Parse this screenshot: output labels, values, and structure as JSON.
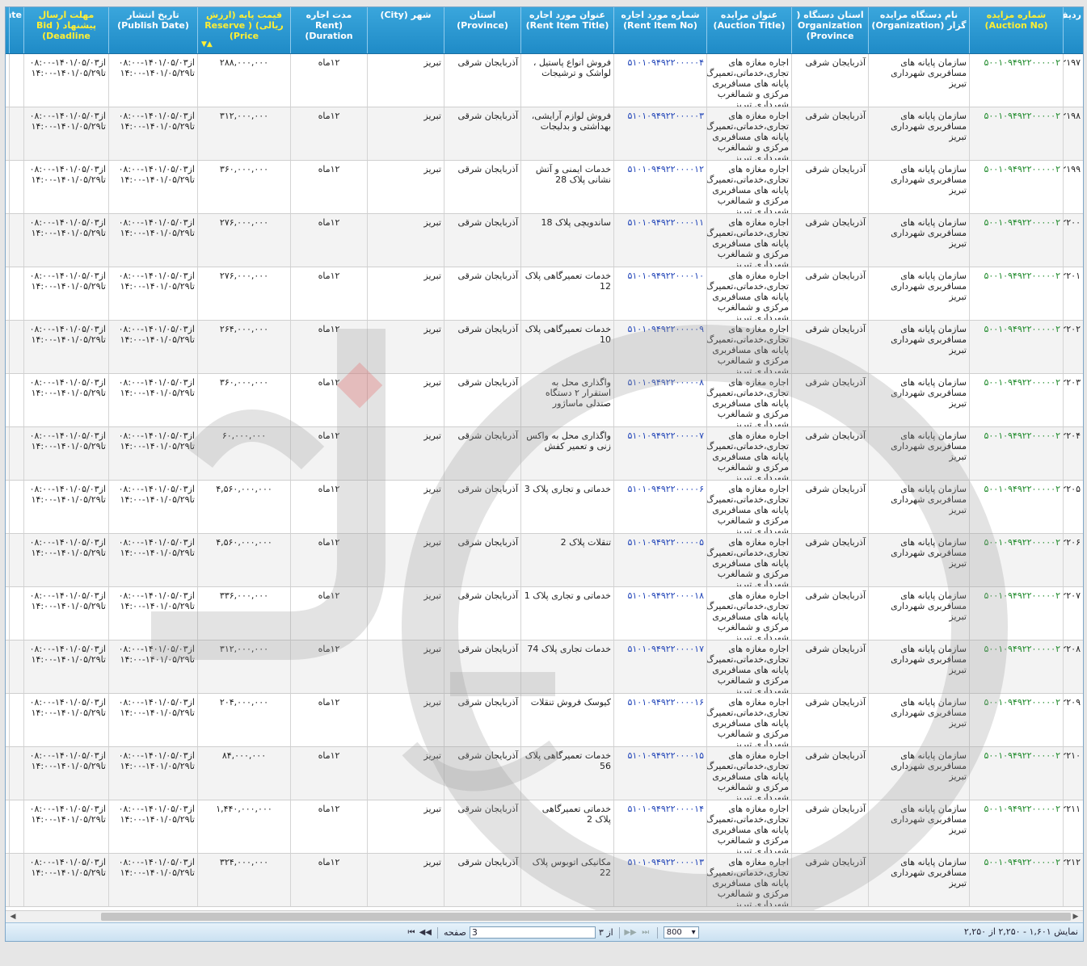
{
  "columns": [
    {
      "key": "row",
      "label": "ردیف"
    },
    {
      "key": "auction_no",
      "label": "شماره مزایده (Auction No)"
    },
    {
      "key": "organization",
      "label": "نام دستگاه مزایده گزار (Organization)"
    },
    {
      "key": "org_province",
      "label": "استان دستگاه ( Organization (Province"
    },
    {
      "key": "auction_title",
      "label": "عنوان مزایده (Auction Title)"
    },
    {
      "key": "rent_item_no",
      "label": "شماره مورد اجاره (Rent Item No)"
    },
    {
      "key": "rent_item_title",
      "label": "عنوان مورد اجاره (Rent Item Title)"
    },
    {
      "key": "province",
      "label": "استان (Province)"
    },
    {
      "key": "city",
      "label": "شهر (City)"
    },
    {
      "key": "rent_duration",
      "label": "مدت اجاره (Rent Duration)"
    },
    {
      "key": "price",
      "label": "قیمت پایه (ارزش ریالی) ( Reserve (Price"
    },
    {
      "key": "publish_date",
      "label": "تاریخ انتشار (Publish Date)"
    },
    {
      "key": "deadline",
      "label": "مهلت ارسال پیشنهاد ( Bid (Deadline"
    },
    {
      "key": "extra",
      "label": "ate"
    }
  ],
  "common": {
    "auction_no": "۵۰۰۱۰۹۴۹۲۲۰۰۰۰۰۲",
    "organization": "سازمان پایانه های مسافربری شهرداری تبریز",
    "org_province": "آذربایجان شرقی",
    "auction_title": "اجاره مغازه های تجاری،خدماتی،تعمیرگ پایانه های مسافربری مرکزی و شمالغرب شهرداری تبریز",
    "province": "آذربایجان شرقی",
    "city": "تبریز",
    "rent_duration": "۱۲ماه",
    "publish_from": "از۱۴۰۱/۰۵/۰۳-۰۸:۰۰",
    "publish_to": "تا۱۴۰۱/۰۵/۲۹-۱۴:۰۰",
    "deadline_from": "از۱۴۰۱/۰۵/۰۳-۰۸:۰۰",
    "deadline_to": "تا۱۴۰۱/۰۵/۲۹-۱۴:۰۰"
  },
  "rows": [
    {
      "row": "۲۱۹۷",
      "rent_item_no": "۵۱۰۱۰۹۴۹۲۲۰۰۰۰۰۴",
      "rent_item_title": "فروش انواع پاستیل ، لواشک و ترشیجات",
      "price": "۲۸۸,۰۰۰,۰۰۰"
    },
    {
      "row": "۲۱۹۸",
      "rent_item_no": "۵۱۰۱۰۹۴۹۲۲۰۰۰۰۰۳",
      "rent_item_title": "فروش لوازم آرایشی، بهداشتی و بدلیجات",
      "price": "۳۱۲,۰۰۰,۰۰۰"
    },
    {
      "row": "۲۱۹۹",
      "rent_item_no": "۵۱۰۱۰۹۴۹۲۲۰۰۰۰۱۲",
      "rent_item_title": "خدمات ایمنی و آتش نشانی پلاک 28",
      "price": "۳۶۰,۰۰۰,۰۰۰"
    },
    {
      "row": "۲۲۰۰",
      "rent_item_no": "۵۱۰۱۰۹۴۹۲۲۰۰۰۰۱۱",
      "rent_item_title": "ساندویچی پلاک 18",
      "price": "۲۷۶,۰۰۰,۰۰۰"
    },
    {
      "row": "۲۲۰۱",
      "rent_item_no": "۵۱۰۱۰۹۴۹۲۲۰۰۰۰۱۰",
      "rent_item_title": "خدمات تعمیرگاهی پلاک 12",
      "price": "۲۷۶,۰۰۰,۰۰۰"
    },
    {
      "row": "۲۲۰۲",
      "rent_item_no": "۵۱۰۱۰۹۴۹۲۲۰۰۰۰۰۹",
      "rent_item_title": "خدمات تعمیرگاهی پلاک 10",
      "price": "۲۶۴,۰۰۰,۰۰۰"
    },
    {
      "row": "۲۲۰۳",
      "rent_item_no": "۵۱۰۱۰۹۴۹۲۲۰۰۰۰۰۸",
      "rent_item_title": "واگذاری محل به استقرار ۲ دستگاه صندلی ماساژور",
      "price": "۳۶۰,۰۰۰,۰۰۰"
    },
    {
      "row": "۲۲۰۴",
      "rent_item_no": "۵۱۰۱۰۹۴۹۲۲۰۰۰۰۰۷",
      "rent_item_title": "واگذاری محل به واکس زنی و تعمیر کفش",
      "price": "۶۰,۰۰۰,۰۰۰"
    },
    {
      "row": "۲۲۰۵",
      "rent_item_no": "۵۱۰۱۰۹۴۹۲۲۰۰۰۰۰۶",
      "rent_item_title": "خدماتی و تجاری پلاک 3",
      "price": "۴,۵۶۰,۰۰۰,۰۰۰"
    },
    {
      "row": "۲۲۰۶",
      "rent_item_no": "۵۱۰۱۰۹۴۹۲۲۰۰۰۰۰۵",
      "rent_item_title": "تنقلات پلاک 2",
      "price": "۴,۵۶۰,۰۰۰,۰۰۰"
    },
    {
      "row": "۲۲۰۷",
      "rent_item_no": "۵۱۰۱۰۹۴۹۲۲۰۰۰۰۱۸",
      "rent_item_title": "خدماتی و تجاری پلاک 1",
      "price": "۳۳۶,۰۰۰,۰۰۰"
    },
    {
      "row": "۲۲۰۸",
      "rent_item_no": "۵۱۰۱۰۹۴۹۲۲۰۰۰۰۱۷",
      "rent_item_title": "خدمات تجاری پلاک 74",
      "price": "۳۱۲,۰۰۰,۰۰۰"
    },
    {
      "row": "۲۲۰۹",
      "rent_item_no": "۵۱۰۱۰۹۴۹۲۲۰۰۰۰۱۶",
      "rent_item_title": "کیوسک فروش تنقلات",
      "price": "۲۰۴,۰۰۰,۰۰۰"
    },
    {
      "row": "۲۲۱۰",
      "rent_item_no": "۵۱۰۱۰۹۴۹۲۲۰۰۰۰۱۵",
      "rent_item_title": "خدمات تعمیرگاهی پلاک 56",
      "price": "۸۴,۰۰۰,۰۰۰"
    },
    {
      "row": "۲۲۱۱",
      "rent_item_no": "۵۱۰۱۰۹۴۹۲۲۰۰۰۰۱۴",
      "rent_item_title": "خدماتی تعمیرگاهی پلاک 2",
      "price": "۱,۴۴۰,۰۰۰,۰۰۰"
    },
    {
      "row": "۲۲۱۲",
      "rent_item_no": "۵۱۰۱۰۹۴۹۲۲۰۰۰۰۱۳",
      "rent_item_title": "مکانیکی اتوبوس پلاک 22",
      "price": "۳۲۴,۰۰۰,۰۰۰"
    }
  ],
  "pager": {
    "summary": "نمایش ۱,۶۰۱ - ۲,۲۵۰ از ۲,۲۵۰",
    "page_label": "صفحه",
    "page_value": "3",
    "of_label": "از ۳",
    "page_size": "800",
    "first": "⏮",
    "prev": "◀◀",
    "next": "▶▶",
    "last": "⏭"
  },
  "colors": {
    "header": "#1f8bc7",
    "header_sort": "#ffee33",
    "auction_no": "#1e8a2a",
    "rent_item_no": "#2044b8"
  },
  "icons": {
    "sort": "sort-triangle-icon",
    "page_first": "page-first-icon",
    "page_prev": "page-prev-icon",
    "page_next": "page-next-icon",
    "page_last": "page-last-icon",
    "dropdown": "dropdown-arrow-icon",
    "watermark": "watermark-logo"
  }
}
